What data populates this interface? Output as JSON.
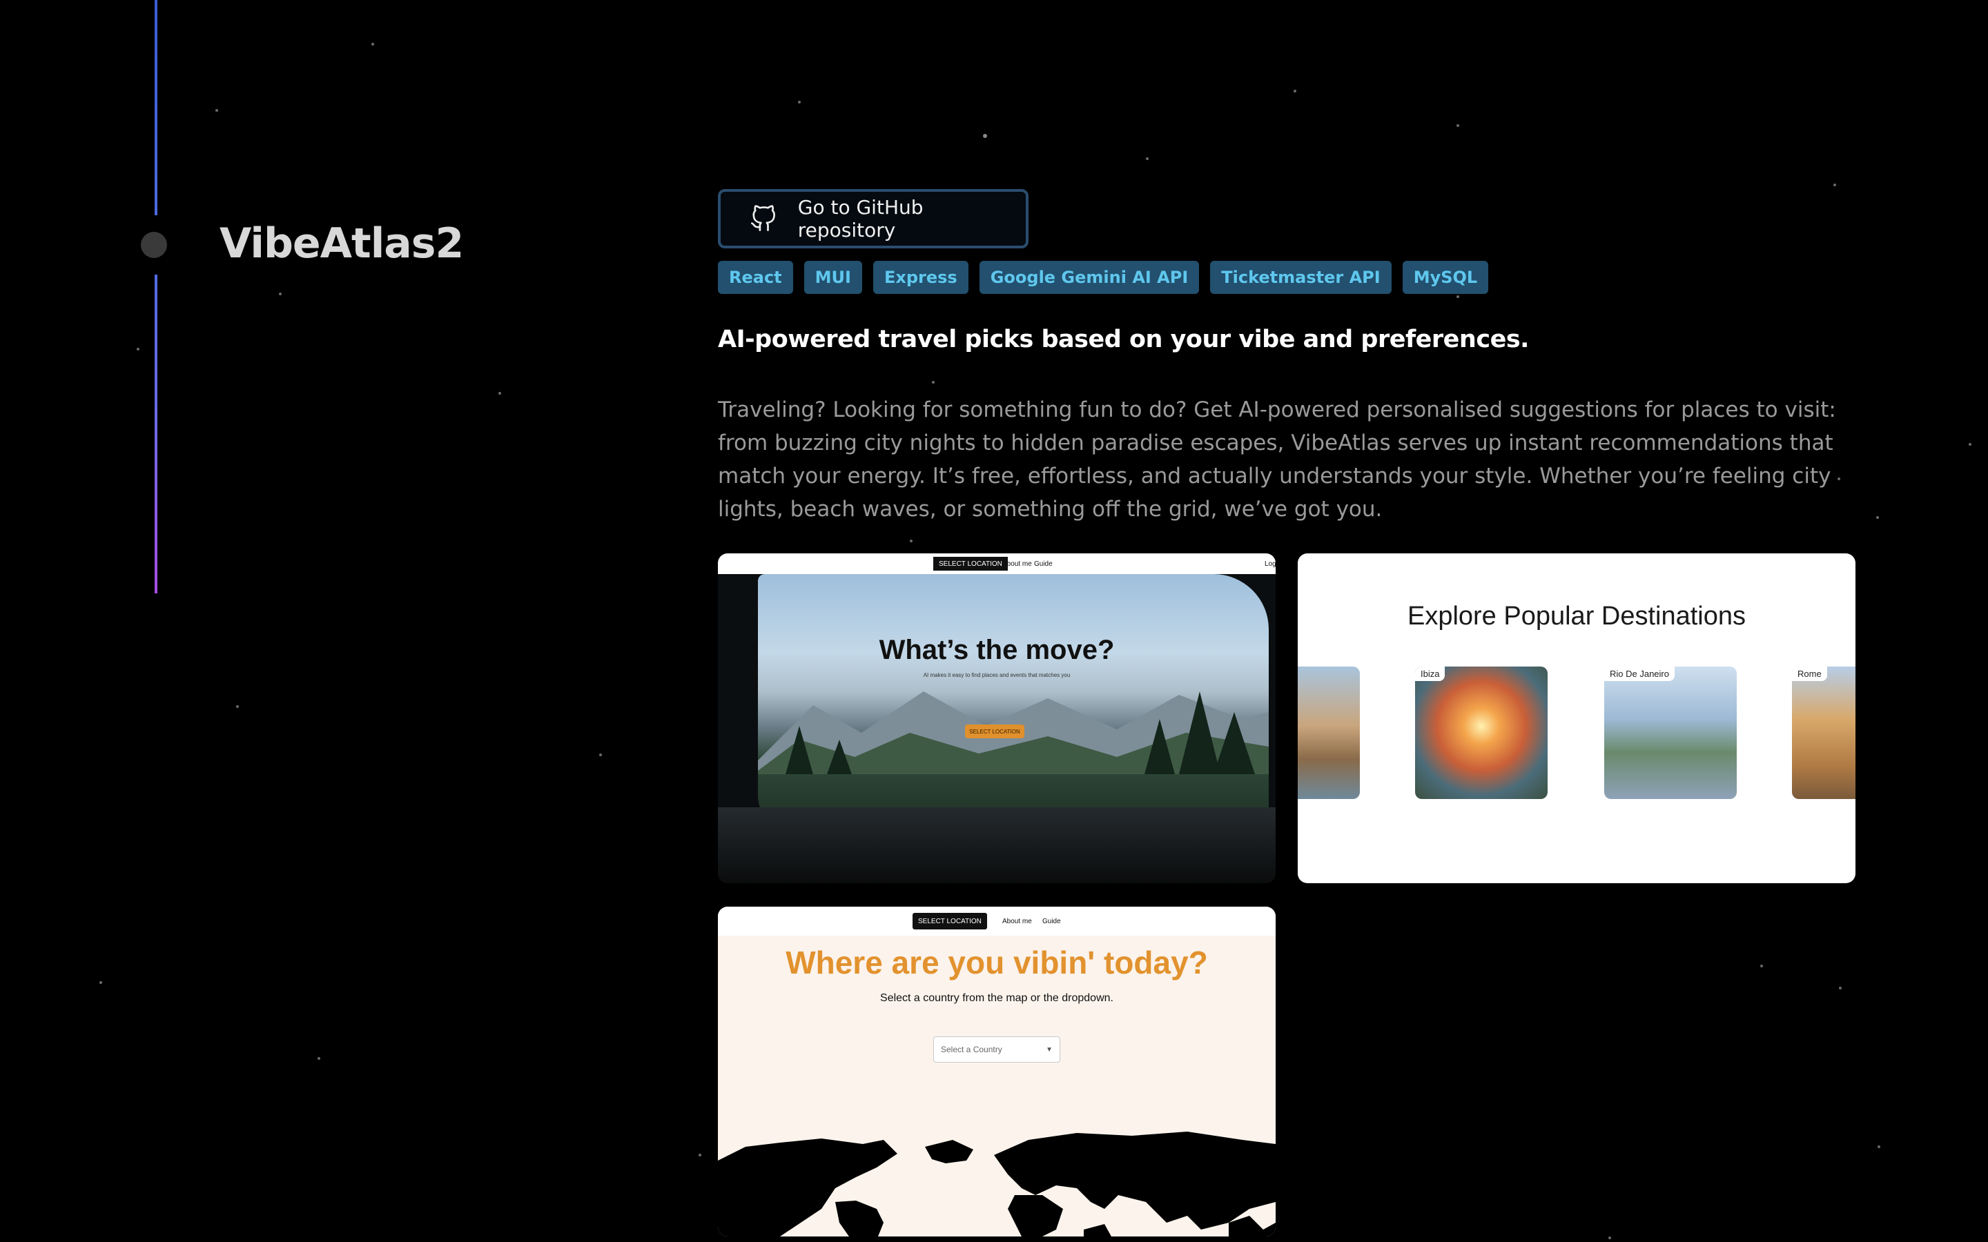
{
  "project": {
    "title": "VibeAtlas2"
  },
  "github_button": {
    "label": "Go to GitHub repository"
  },
  "tags": [
    "React",
    "MUI",
    "Express",
    "Google Gemini AI API",
    "Ticketmaster API",
    "MySQL"
  ],
  "tagline": "AI-powered travel picks based on your vibe and preferences.",
  "description": "Traveling? Looking for something fun to do? Get AI-powered personalised suggestions for places to visit: from buzzing city nights to hidden paradise escapes, VibeAtlas serves up instant recommendations that match your energy. It’s free, effortless, and actually understands your style. Whether you’re feeling city lights, beach waves, or something off the grid, we’ve got you.",
  "screenshot1": {
    "nav": [
      "SELECT LOCATION",
      "About me",
      "Guide",
      "Logi"
    ],
    "headline": "What’s the move?",
    "subtitle": "AI makes it easy to find places and events that matches you",
    "cta": "SELECT LOCATION"
  },
  "screenshot2": {
    "title": "Explore Popular Destinations",
    "destinations": [
      "Ibiza",
      "Rio De Janeiro",
      "Rome"
    ]
  },
  "screenshot3": {
    "nav": [
      "SELECT LOCATION",
      "About me",
      "Guide"
    ],
    "headline": "Where are you vibin' today?",
    "subtitle": "Select a country from the map or the dropdown.",
    "select_placeholder": "Select a Country"
  },
  "colors": {
    "tag_bg": "#22506e",
    "tag_text": "#5fc7ee",
    "timeline_top": "#3b5bd6",
    "timeline_bottom": "#a64de6",
    "vibin_orange": "#e2922e"
  }
}
